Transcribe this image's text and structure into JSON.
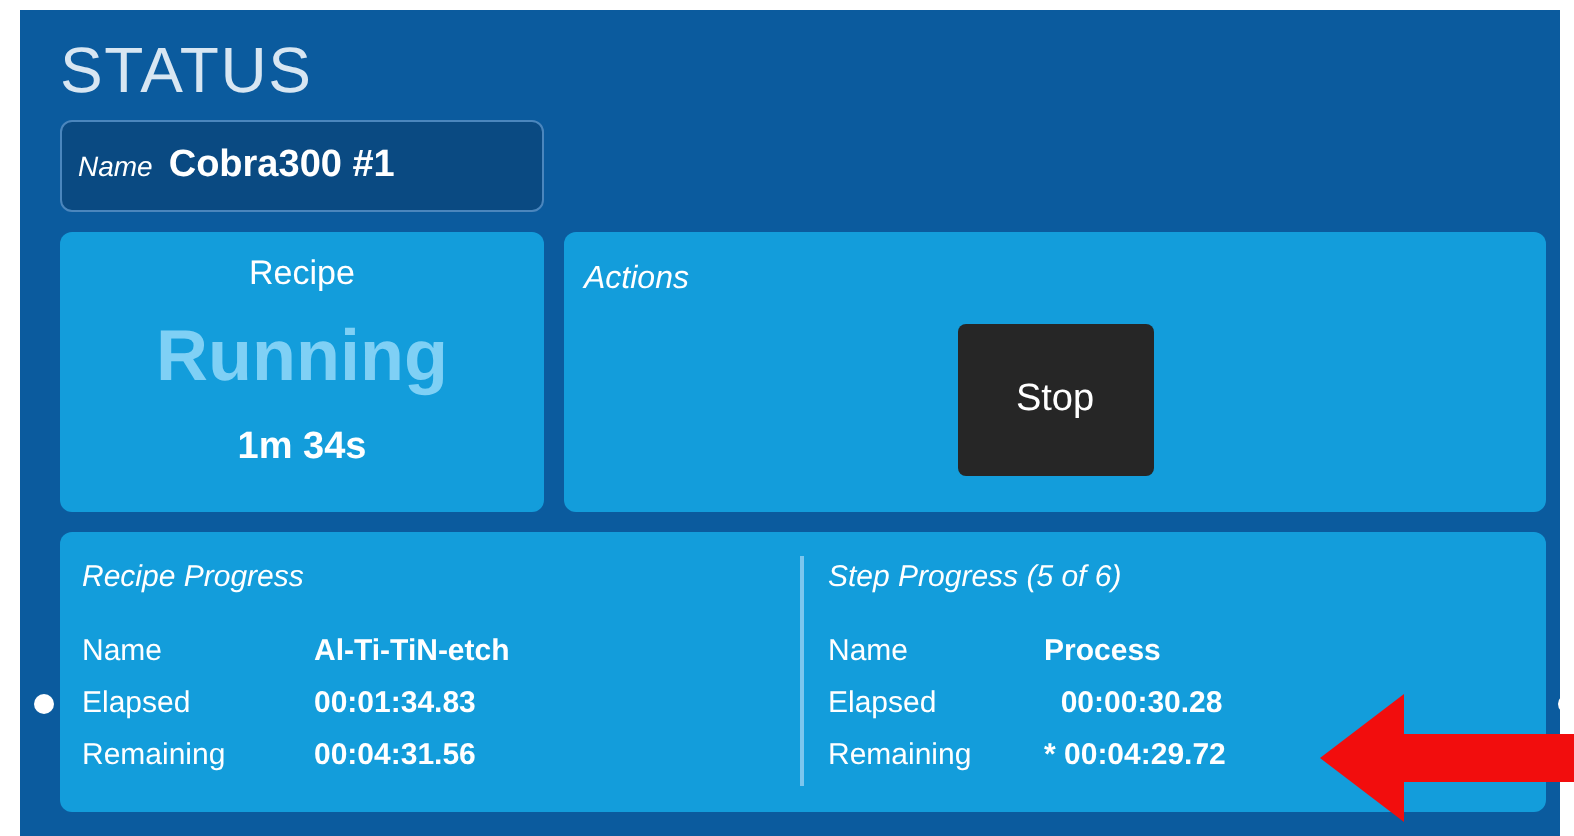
{
  "title": "STATUS",
  "name_field": {
    "label": "Name",
    "value": "Cobra300 #1"
  },
  "recipe": {
    "title": "Recipe",
    "state": "Running",
    "time": "1m 34s"
  },
  "actions": {
    "title": "Actions",
    "buttons": [
      "Stop"
    ]
  },
  "recipe_progress": {
    "title": "Recipe Progress",
    "rows": [
      {
        "label": "Name",
        "value": "Al-Ti-TiN-etch"
      },
      {
        "label": "Elapsed",
        "value": "00:01:34.83"
      },
      {
        "label": "Remaining",
        "value": "00:04:31.56"
      }
    ]
  },
  "step_progress": {
    "title": "Step Progress (5 of 6)",
    "rows": [
      {
        "label": "Name",
        "value": "Process"
      },
      {
        "label": "Elapsed",
        "value": "  00:00:30.28"
      },
      {
        "label": "Remaining",
        "value": "* 00:04:29.72"
      }
    ]
  }
}
